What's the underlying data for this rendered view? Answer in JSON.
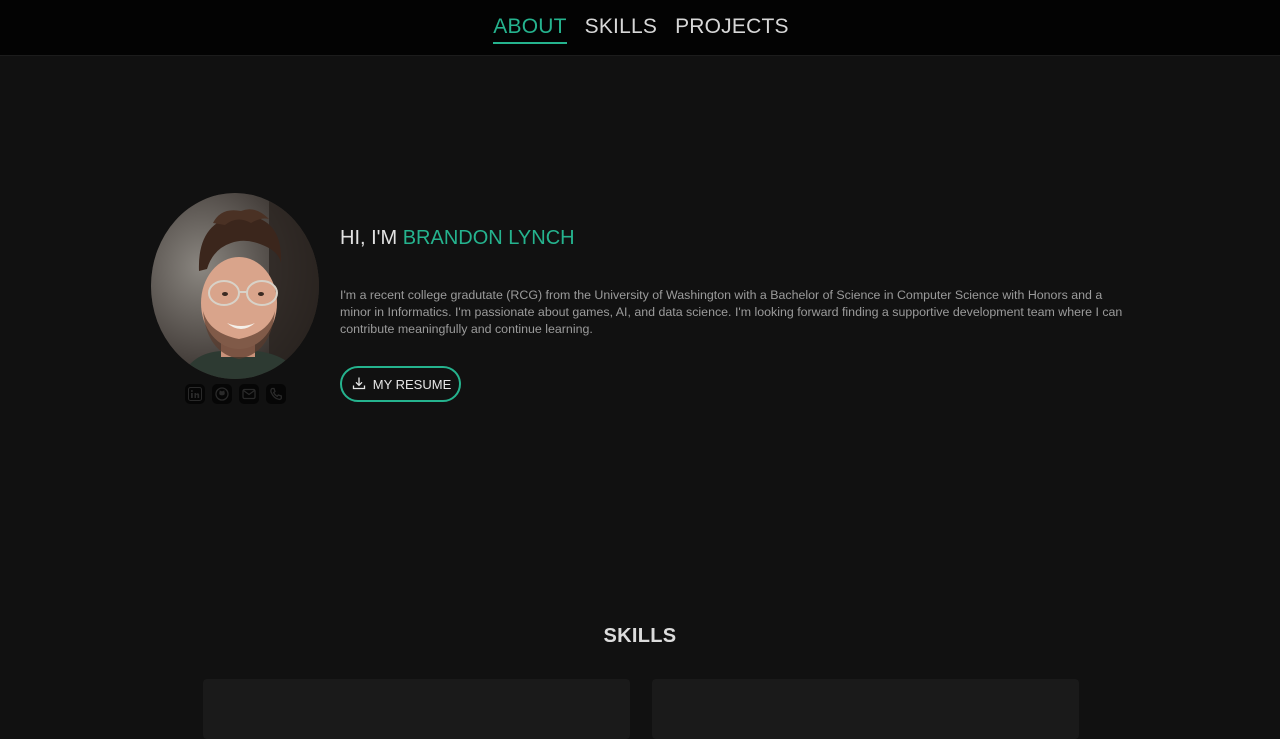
{
  "nav": {
    "items": [
      {
        "label": "ABOUT",
        "active": true
      },
      {
        "label": "SKILLS",
        "active": false
      },
      {
        "label": "PROJECTS",
        "active": false
      }
    ]
  },
  "hero": {
    "greeting": "HI, I'M ",
    "name": "BRANDON LYNCH",
    "bio": "I'm a recent college gradutate (RCG) from the University of Washington with a Bachelor of Science in Computer Science with Honors and a minor in Informatics. I'm passionate about games, AI, and data science. I'm looking forward finding a supportive development team where I can contribute meaningfully and continue learning.",
    "resume_label": "MY RESUME",
    "social_icons": [
      "linkedin-icon",
      "github-icon",
      "email-icon",
      "phone-icon"
    ]
  },
  "skills": {
    "heading": "SKILLS"
  },
  "colors": {
    "accent": "#25b38e",
    "background": "#111111",
    "nav_background": "#030303"
  }
}
